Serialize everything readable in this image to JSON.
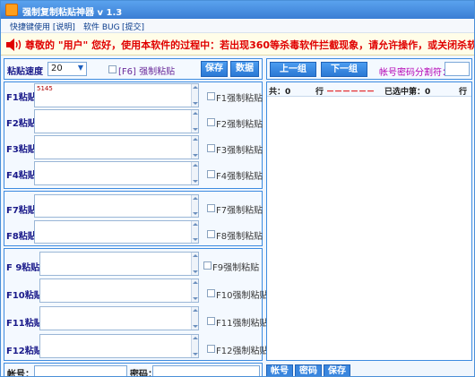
{
  "window": {
    "title": "强制复制粘贴神器 v 1.3"
  },
  "menu": [
    "快捷键使用 [说明]",
    "软件 BUG",
    "[提交]"
  ],
  "notice": "尊敬的 \"用户\" 您好，使用本软件的过程中：若出现360等杀毒软件拦截现象，请允许操作，或关闭杀软！",
  "toolbar": {
    "speed_label": "粘贴速度",
    "speed_value": "20",
    "f6_label": "[F6] 强制粘贴",
    "save_label": "保存",
    "data_label": "数据"
  },
  "slots": [
    {
      "key": "F1粘贴",
      "value": "5145",
      "check": "F1强制粘贴"
    },
    {
      "key": "F2粘贴",
      "value": "",
      "check": "F2强制粘贴"
    },
    {
      "key": "F3粘贴",
      "value": "",
      "check": "F3强制粘贴"
    },
    {
      "key": "F4粘贴",
      "value": "",
      "check": "F4强制粘贴"
    },
    {
      "key": "F7粘贴",
      "value": "",
      "check": "F7强制粘贴"
    },
    {
      "key": "F8粘贴",
      "value": "",
      "check": "F8强制粘贴"
    },
    {
      "key": "F 9粘贴",
      "value": "",
      "check": "F9强制粘贴"
    },
    {
      "key": "F10粘贴",
      "value": "",
      "check": "F10强制粘贴"
    },
    {
      "key": "F11粘贴",
      "value": "",
      "check": "F11强制粘贴"
    },
    {
      "key": "F12粘贴",
      "value": "",
      "check": "F12强制粘贴"
    }
  ],
  "right": {
    "prev_label": "上一组",
    "next_label": "下一组",
    "separator_label": "帐号密码分割符：",
    "status": {
      "total": "共：0",
      "row": "行",
      "dashes": "－－－－－－",
      "selected": "已选中第：0",
      "row_end": "行"
    }
  },
  "bottom": {
    "account_label": "帐号：",
    "password_label": "密码：",
    "account_btn": "帐号",
    "password_btn": "密码",
    "save_btn": "保存"
  }
}
